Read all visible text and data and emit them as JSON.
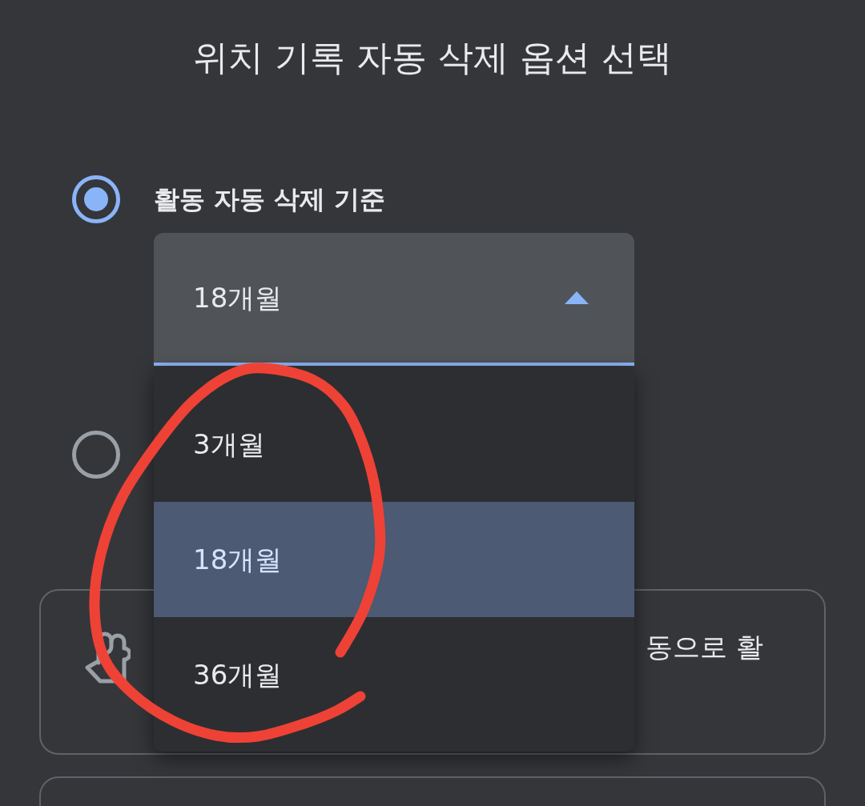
{
  "title": "위치 기록 자동 삭제 옵션 선택",
  "options": [
    {
      "selected": true,
      "label": "활동 자동 삭제 기준",
      "dropdown": {
        "value": "18개월",
        "expanded": true,
        "items": [
          {
            "label": "3개월",
            "selected": false
          },
          {
            "label": "18개월",
            "selected": true
          },
          {
            "label": "36개월",
            "selected": false
          }
        ]
      }
    },
    {
      "selected": false
    }
  ],
  "cards": [
    {
      "kind": "tip",
      "text": "동으로 활"
    },
    {
      "kind": "blank"
    }
  ],
  "annotations": [
    {
      "kind": "freehand-loop"
    }
  ]
}
